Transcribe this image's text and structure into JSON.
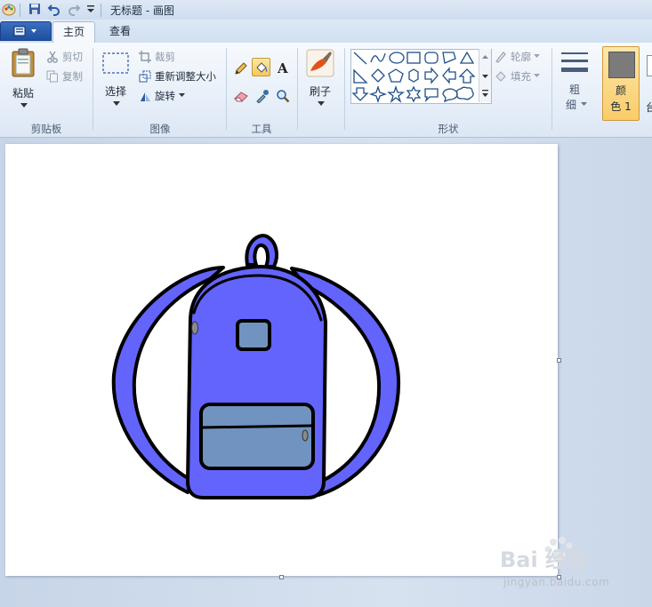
{
  "window": {
    "title": "无标题 - 画图"
  },
  "tabs": [
    {
      "label": "主页",
      "active": true
    },
    {
      "label": "查看",
      "active": false
    }
  ],
  "clipboard": {
    "paste_label": "粘贴",
    "cut_label": "剪切",
    "copy_label": "复制",
    "group_label": "剪贴板"
  },
  "image": {
    "select_label": "选择",
    "crop_label": "裁剪",
    "resize_label": "重新调整大小",
    "rotate_label": "旋转",
    "group_label": "图像"
  },
  "tools": {
    "group_label": "工具",
    "items": [
      "pencil-icon",
      "fill-bucket-icon",
      "text-icon",
      "eraser-icon",
      "color-picker-icon",
      "magnifier-icon"
    ],
    "active": "fill-bucket-icon"
  },
  "brushes": {
    "label": "刷子"
  },
  "shapes": {
    "group_label": "形状",
    "outline_label": "轮廓",
    "fill_label": "填充"
  },
  "size": {
    "label_line1": "粗",
    "label_line2": "细"
  },
  "colors": {
    "color1_line1": "颜",
    "color1_line2": "色 1",
    "color1_value": "#7b7b7b",
    "color2_partial": "台"
  },
  "drawing": {
    "backpack_body": "#6264fb",
    "pocket_fill": "#7193bf",
    "outline": "#000000"
  },
  "watermark": {
    "brand": "Bai 经验",
    "sub": "jingyan.baidu.com"
  }
}
